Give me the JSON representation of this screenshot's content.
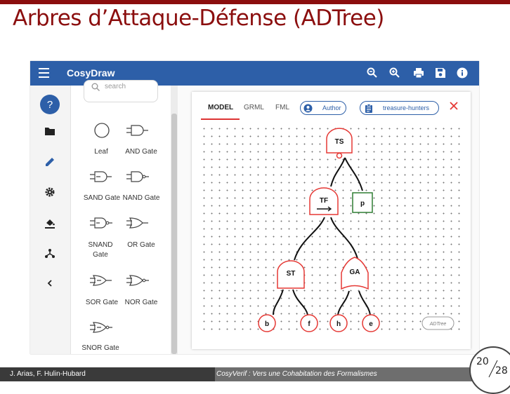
{
  "slide": {
    "title": "Arbres d’Attaque-Défense (ADTree)",
    "footer_authors": "J. Arias, F. Hulin-Hubard",
    "footer_talk": "CosyVerif : Vers une Cohabitation des Formalismes",
    "page_current": "20",
    "page_total": "28"
  },
  "app": {
    "title": "CosyDraw",
    "toolbar_icons": [
      "zoom-out-icon",
      "zoom-in-icon",
      "print-icon",
      "save-icon",
      "info-icon"
    ],
    "rail": {
      "help_label": "?",
      "icons": [
        "help-icon",
        "folder-icon",
        "pencil-icon",
        "gear-icon",
        "paint-bucket-icon",
        "hierarchy-icon",
        "chevron-left-icon"
      ]
    },
    "palette": {
      "search_placeholder": "search",
      "items": [
        "Leaf",
        "AND Gate",
        "SAND Gate",
        "NAND Gate",
        "SNAND Gate",
        "OR Gate",
        "SOR Gate",
        "NOR Gate",
        "SNOR Gate"
      ]
    },
    "tabs": [
      "MODEL",
      "GRML",
      "FML"
    ],
    "active_tab": "MODEL",
    "author_chip": "Author",
    "model_chip": "treasure-hunters",
    "watermark": "ADTree",
    "tree": {
      "root": "TS",
      "nodes": [
        "TS",
        "TF",
        "p",
        "ST",
        "GA",
        "b",
        "f",
        "h",
        "e"
      ]
    }
  },
  "colors": {
    "accent": "#2d5fa8",
    "attack": "#e53935",
    "defense": "#2e7d32",
    "slide_title": "#8b0e0e"
  }
}
